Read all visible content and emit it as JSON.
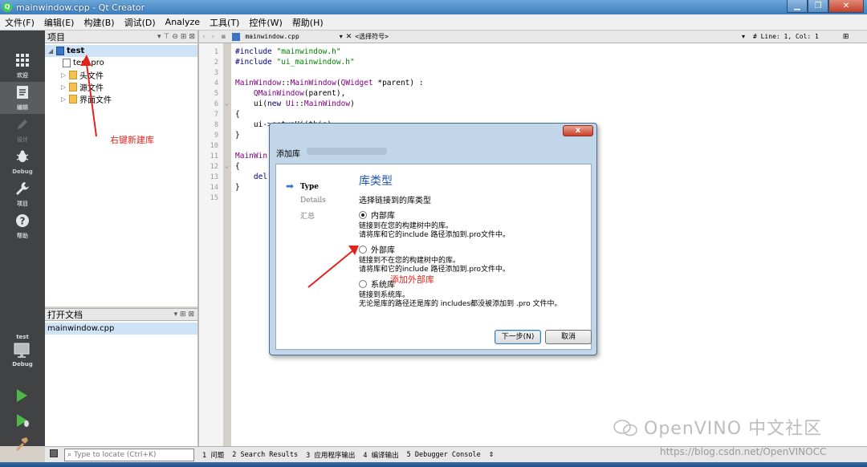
{
  "window": {
    "title": "mainwindow.cpp - Qt Creator"
  },
  "menu": [
    "文件(F)",
    "编辑(E)",
    "构建(B)",
    "调试(D)",
    "Analyze",
    "工具(T)",
    "控件(W)",
    "帮助(H)"
  ],
  "modes": [
    {
      "label": "欢迎",
      "icon": "grid-icon"
    },
    {
      "label": "编辑",
      "icon": "edit-icon"
    },
    {
      "label": "设计",
      "icon": "pencil-icon"
    },
    {
      "label": "Debug",
      "icon": "bug-icon"
    },
    {
      "label": "项目",
      "icon": "wrench-icon"
    },
    {
      "label": "帮助",
      "icon": "help-icon"
    }
  ],
  "run_target": {
    "project": "test",
    "label": "Debug"
  },
  "project_panel": {
    "title": "项目",
    "tree": [
      {
        "label": "test"
      },
      {
        "label": "test.pro"
      },
      {
        "label": "头文件"
      },
      {
        "label": "源文件"
      },
      {
        "label": "界面文件"
      }
    ]
  },
  "open_docs": {
    "title": "打开文档",
    "items": [
      "mainwindow.cpp"
    ]
  },
  "editor": {
    "file": "mainwindow.cpp",
    "symbol": "<选择符号>",
    "position": "#  Line: 1, Col: 1",
    "line_numbers": [
      "1",
      "2",
      "3",
      "4",
      "5",
      "6",
      "7",
      "8",
      "9",
      "10",
      "11",
      "12",
      "13",
      "14",
      "15"
    ]
  },
  "dialog": {
    "title": "添加库",
    "close": "x",
    "steps": [
      "Type",
      "Details",
      "汇总"
    ],
    "page_title": "库类型",
    "subtitle": "选择链接到的库类型",
    "options": [
      {
        "label": "内部库",
        "desc1": "链接到在您的构建树中的库。",
        "desc2": "请将库和它的include 路径添加到.pro文件中。"
      },
      {
        "label": "外部库",
        "desc1": "链接到不在您的构建树中的库。",
        "desc2": "请将库和它的include 路径添加到.pro文件中。"
      },
      {
        "label": "系统库",
        "desc1": "链接到系统库。",
        "desc2": "无论是库的路径还是库的 includes都没被添加到 .pro 文件中。"
      }
    ],
    "next": "下一步(N)",
    "cancel": "取消"
  },
  "annotations": {
    "right_click": "右键新建库",
    "add_external": "添加外部库"
  },
  "statusbar": {
    "locate_placeholder": "Type to locate (Ctrl+K)",
    "panes": [
      "1 问题",
      "2 Search Results",
      "3 应用程序输出",
      "4 编译输出",
      "5 Debugger Console"
    ]
  },
  "watermark": {
    "text": "OpenVINO 中文社区",
    "url": "https://blog.csdn.net/OpenVINOCC"
  },
  "colors": {
    "accent": "#1f55a8",
    "annotation": "#e0241b",
    "modebar": "#404244"
  }
}
